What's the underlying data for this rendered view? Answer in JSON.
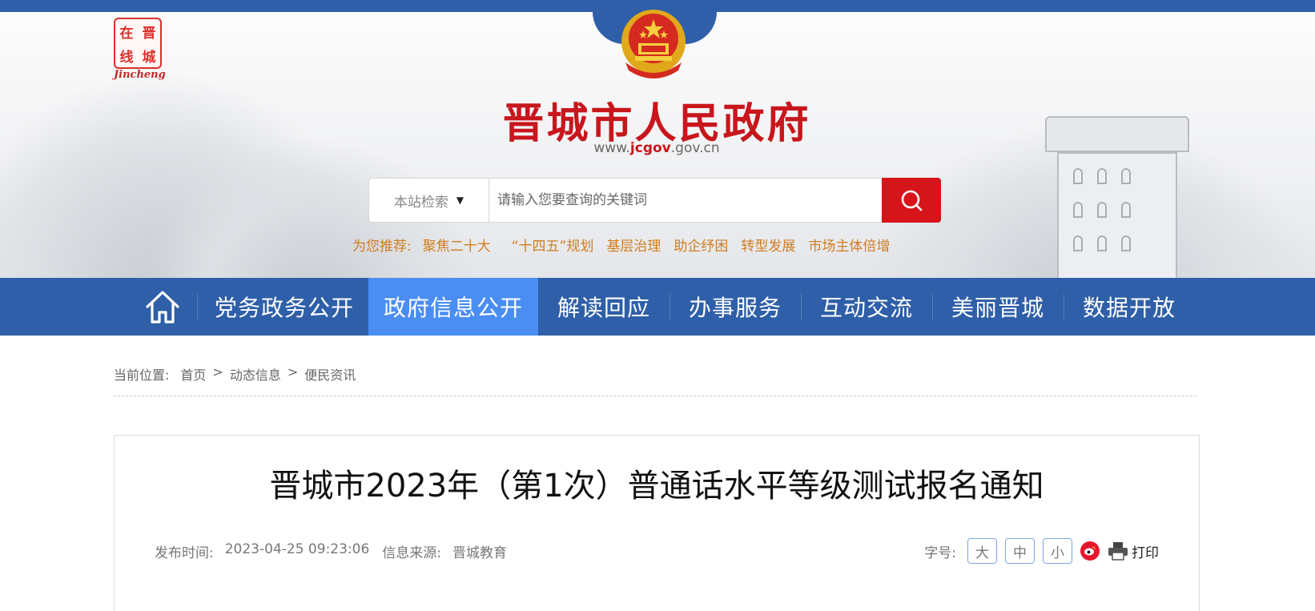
{
  "header": {
    "logo": {
      "text_cells": [
        "在",
        "晋",
        "线",
        "城"
      ],
      "english": "Jincheng"
    },
    "site_title": "晋城市人民政府",
    "site_url": {
      "prefix": "www.",
      "highlight": "jcgov",
      "suffix": ".gov.cn"
    }
  },
  "search": {
    "scope_label": "本站检索",
    "scope_caret": "▼",
    "placeholder": "请输入您要查询的关键词",
    "button_icon": "search-icon"
  },
  "recommend": {
    "lead": "为您推荐:",
    "items": [
      "聚焦二十大",
      "“十四五”规划",
      "基层治理",
      "助企纾困",
      "转型发展",
      "市场主体倍增"
    ]
  },
  "nav": {
    "home_icon": "home-icon",
    "items": [
      "党务政务公开",
      "政府信息公开",
      "解读回应",
      "办事服务",
      "互动交流",
      "美丽晋城",
      "数据开放"
    ],
    "active_index": 1
  },
  "breadcrumb": {
    "label": "当前位置:",
    "items": [
      "首页",
      "动态信息",
      "便民资讯"
    ],
    "separator": ">"
  },
  "article": {
    "title": "晋城市2023年（第1次）普通话水平等级测试报名通知",
    "publish_label": "发布时间:",
    "publish_time": "2023-04-25 09:23:06",
    "source_label": "信息来源:",
    "source": "晋城教育",
    "font_size_label": "字号:",
    "font_sizes": [
      "大",
      "中",
      "小"
    ],
    "share_icon": "weibo-icon",
    "print_label": "打印"
  },
  "colors": {
    "primary_blue": "#2f5fa8",
    "active_tab": "#4a8df3",
    "brand_red": "#c8161d",
    "search_button": "#d6151b",
    "recommend_orange": "#d07d1f"
  }
}
